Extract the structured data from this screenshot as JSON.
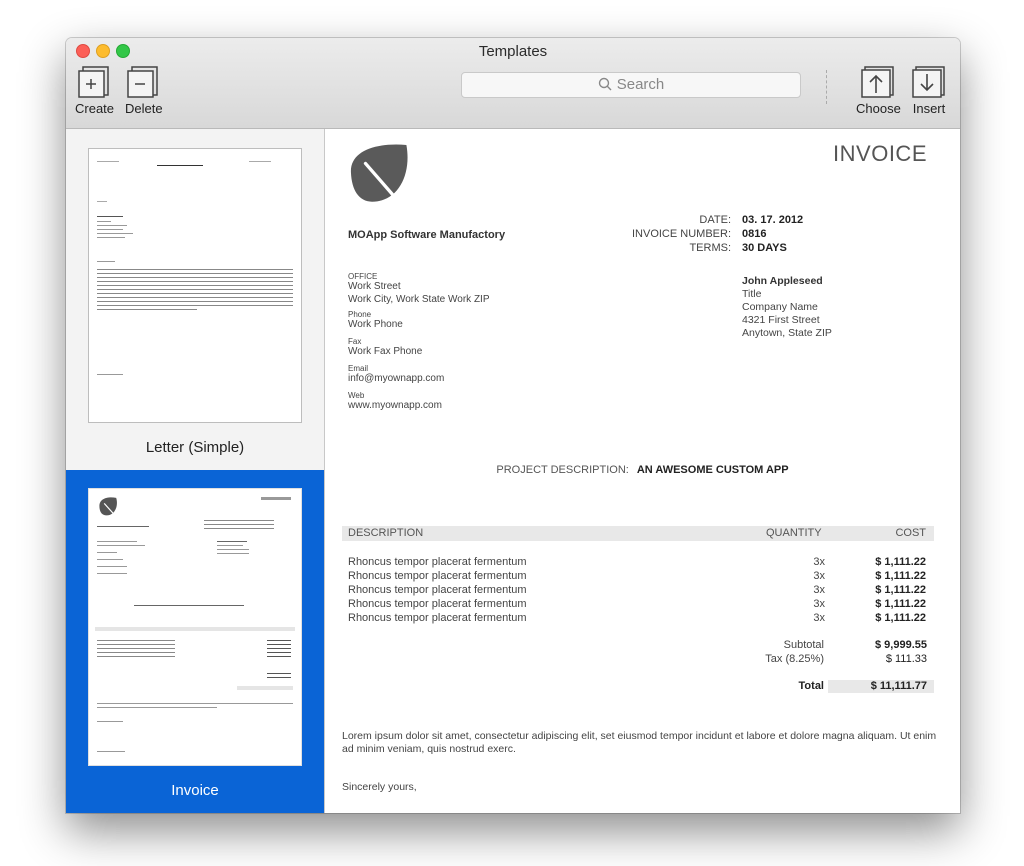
{
  "window": {
    "title": "Templates"
  },
  "toolbar": {
    "create_label": "Create",
    "delete_label": "Delete",
    "search_placeholder": "Search",
    "choose_label": "Choose",
    "insert_label": "Insert"
  },
  "sidebar": {
    "items": [
      {
        "label": "Letter (Simple)",
        "selected": false
      },
      {
        "label": "Invoice",
        "selected": true
      }
    ]
  },
  "colors": {
    "selection": "#0a64d6",
    "header_bg": "#e8e8e8"
  },
  "invoice": {
    "heading": "INVOICE",
    "logo_icon": "leaf-icon",
    "company": "MOApp Software Manufactory",
    "meta": [
      {
        "label": "DATE:",
        "value": "03. 17. 2012"
      },
      {
        "label": "INVOICE NUMBER:",
        "value": "0816"
      },
      {
        "label": "TERMS:",
        "value": "30 DAYS"
      }
    ],
    "contact": [
      {
        "label": "OFFICE",
        "lines": [
          "Work Street",
          "Work City, Work State Work ZIP"
        ]
      },
      {
        "label": "Phone",
        "lines": [
          "Work Phone"
        ]
      },
      {
        "label": "Fax",
        "lines": [
          "Work Fax Phone"
        ]
      },
      {
        "label": "Email",
        "lines": [
          "info@myownapp.com"
        ]
      },
      {
        "label": "Web",
        "lines": [
          "www.myownapp.com"
        ]
      }
    ],
    "bill_to": {
      "name": "John Appleseed",
      "title": "Title",
      "company": "Company Name",
      "street": "4321 First Street",
      "city": "Anytown, State ZIP"
    },
    "project": {
      "label": "PROJECT DESCRIPTION:",
      "value": "AN AWESOME CUSTOM APP"
    },
    "table": {
      "headers": {
        "description": "DESCRIPTION",
        "quantity": "QUANTITY",
        "cost": "COST"
      },
      "rows": [
        {
          "description": "Rhoncus tempor placerat fermentum",
          "quantity": "3x",
          "cost": "$ 1,111.22"
        },
        {
          "description": "Rhoncus tempor placerat fermentum",
          "quantity": "3x",
          "cost": "$ 1,111.22"
        },
        {
          "description": "Rhoncus tempor placerat fermentum",
          "quantity": "3x",
          "cost": "$ 1,111.22"
        },
        {
          "description": "Rhoncus tempor placerat fermentum",
          "quantity": "3x",
          "cost": "$ 1,111.22"
        },
        {
          "description": "Rhoncus tempor placerat fermentum",
          "quantity": "3x",
          "cost": "$ 1,111.22"
        }
      ]
    },
    "subtotal": {
      "label": "Subtotal",
      "value": "$ 9,999.55"
    },
    "tax": {
      "label": "Tax (8.25%)",
      "value": "$ 111.33"
    },
    "total": {
      "label": "Total",
      "value": "$ 11,111.77"
    },
    "notes": "Lorem ipsum dolor sit amet, consectetur adipiscing elit, set eiusmod tempor incidunt et labore et dolore magna aliquam. Ut enim ad minim veniam, quis nostrud exerc.",
    "closing": "Sincerely yours,"
  }
}
